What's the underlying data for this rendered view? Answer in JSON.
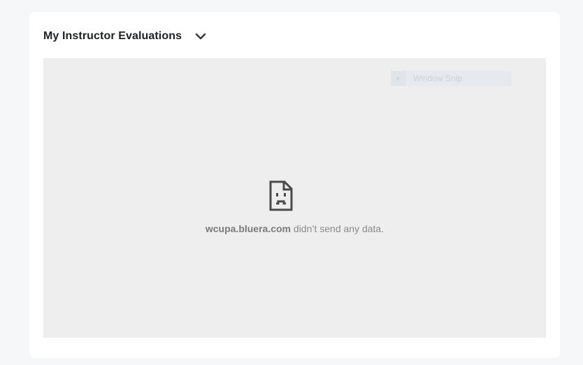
{
  "widget": {
    "title": "My Instructor Evaluations",
    "collapse_icon": "chevron-down-icon"
  },
  "overlay": {
    "label": "Window Snip",
    "icon": "play-icon"
  },
  "error": {
    "icon": "sad-page-icon",
    "host": "wcupa.bluera.com",
    "message": " didn’t send any data."
  },
  "colors": {
    "page_background": "#f6f7f9",
    "card_background": "#ffffff",
    "frame_background": "#eeeeee",
    "title_text": "#202122",
    "error_text": "#8a8a8a"
  }
}
